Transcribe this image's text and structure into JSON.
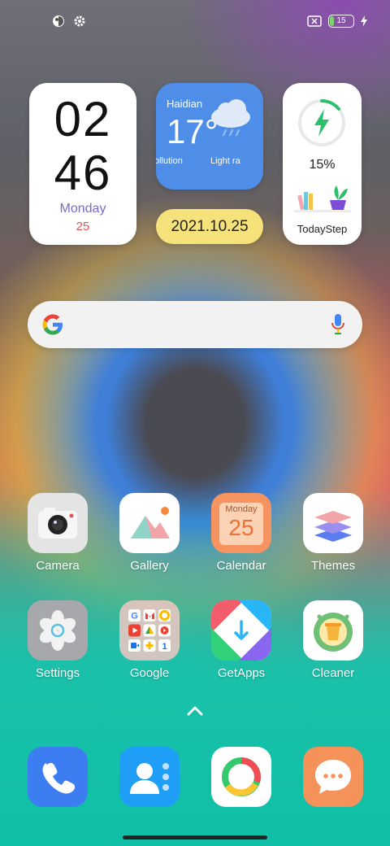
{
  "status": {
    "left_icons": [
      "vpn-shield-icon",
      "settings-gear-icon"
    ],
    "battery_level": "15",
    "battery_percent": 15,
    "charging": true
  },
  "clock_widget": {
    "hour": "02",
    "minute": "46",
    "day": "Monday",
    "date": "25"
  },
  "weather_widget": {
    "city": "Haidian",
    "temperature": "17°",
    "pollution_label": "ollution",
    "condition_label": "Light ra"
  },
  "date_widget": {
    "date": "2021.10.25"
  },
  "step_widget": {
    "percent": "15%",
    "label": "TodayStep"
  },
  "search_bar": {
    "logo": "google-g-icon",
    "mic": "mic-icon"
  },
  "apps": {
    "camera": "Camera",
    "gallery": "Gallery",
    "calendar": "Calendar",
    "calendar_month": "Monday",
    "calendar_day": "25",
    "themes": "Themes",
    "settings": "Settings",
    "google": "Google",
    "getapps": "GetApps",
    "cleaner": "Cleaner"
  },
  "dock": [
    "phone-icon",
    "contacts-icon",
    "browser-icon",
    "messages-icon"
  ],
  "colors": {
    "weather_bg": "#4f8ee8",
    "date_pill": "#f6e27a",
    "calendar_orange": "#f59460",
    "phone_blue": "#3d7df2",
    "contacts_blue": "#1f9ef7",
    "messages_orange": "#f5925a"
  }
}
